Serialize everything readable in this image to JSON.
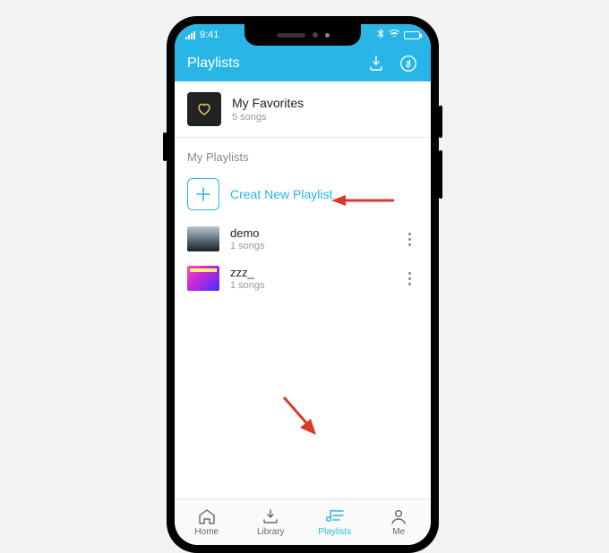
{
  "statusbar": {
    "time": "9:41"
  },
  "header": {
    "title": "Playlists"
  },
  "favorites": {
    "title": "My Favorites",
    "subtitle": "5 songs"
  },
  "section": {
    "my_playlists": "My Playlists"
  },
  "create": {
    "label": "Creat New Playlist"
  },
  "playlists": [
    {
      "title": "demo",
      "subtitle": "1 songs"
    },
    {
      "title": "zzz_",
      "subtitle": "1 songs"
    }
  ],
  "tabs": {
    "home": "Home",
    "library": "Library",
    "playlists": "Playlists",
    "me": "Me"
  },
  "colors": {
    "accent": "#29b6e6"
  }
}
